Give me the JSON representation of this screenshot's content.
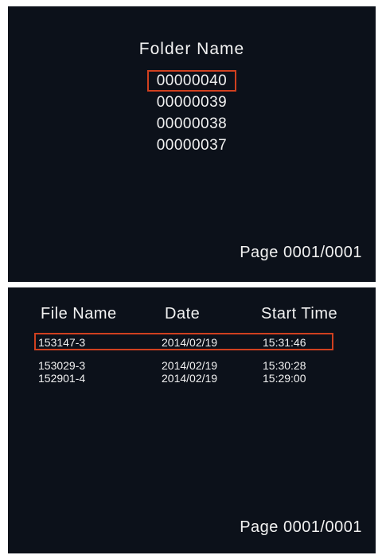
{
  "folder_screen": {
    "title": "Folder Name",
    "folders": [
      "00000040",
      "00000039",
      "00000038",
      "00000037"
    ],
    "selected_index": 0,
    "page": "Page 0001/0001"
  },
  "file_screen": {
    "headers": {
      "name": "File Name",
      "date": "Date",
      "start_time": "Start Time"
    },
    "rows": [
      {
        "name": "153147-3",
        "date": "2014/02/19",
        "start_time": "15:31:46"
      },
      {
        "name": "153029-3",
        "date": "2014/02/19",
        "start_time": "15:30:28"
      },
      {
        "name": "152901-4",
        "date": "2014/02/19",
        "start_time": "15:29:00"
      }
    ],
    "selected_index": 0,
    "page": "Page 0001/0001"
  },
  "colors": {
    "background": "#0c111a",
    "text": "#f2f2f2",
    "highlight": "#d0401f"
  }
}
